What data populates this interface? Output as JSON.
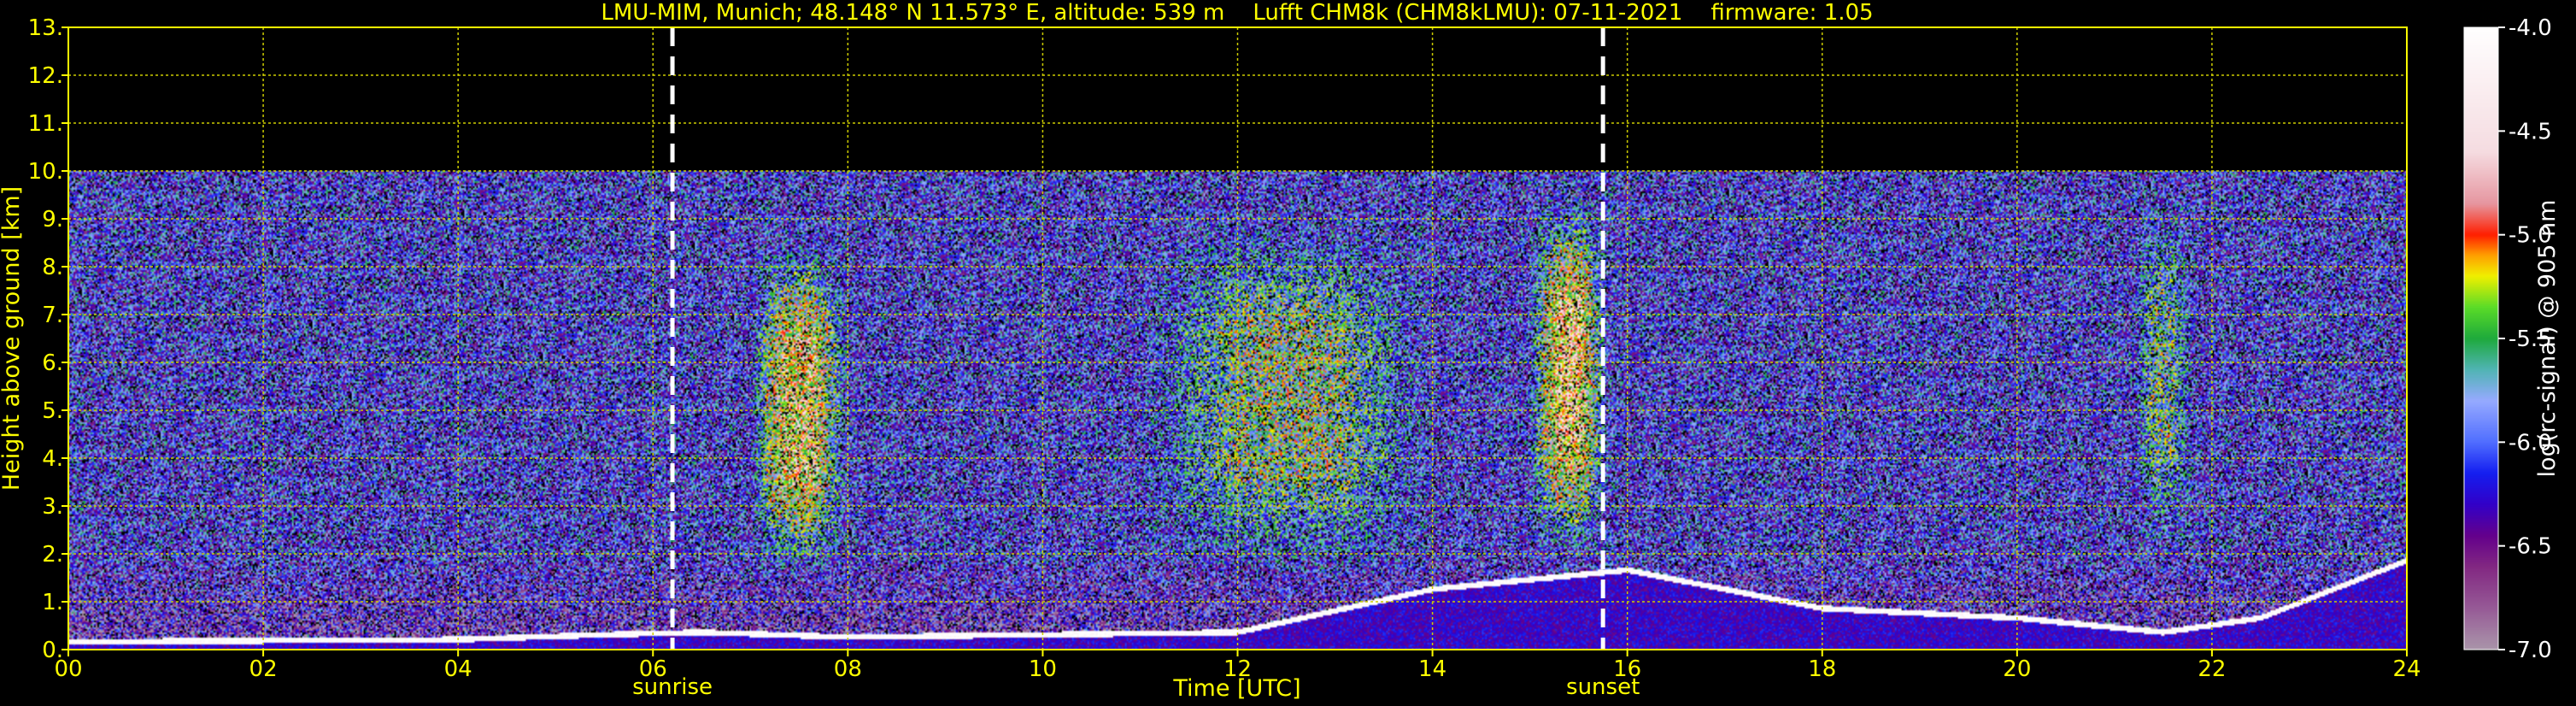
{
  "chart_data": {
    "type": "heatmap",
    "title": "LMU-MIM, Munich; 48.148° N 11.573° E, altitude: 539 m    Lufft CHM8k (CHM8kLMU): 07-11-2021    firmware: 1.05",
    "xlabel": "Time [UTC]",
    "ylabel": "Height above ground [km]",
    "xlim": [
      0,
      24
    ],
    "ylim": [
      0,
      13
    ],
    "x_ticks": [
      "00",
      "02",
      "04",
      "06",
      "08",
      "10",
      "12",
      "14",
      "16",
      "18",
      "20",
      "22",
      "24"
    ],
    "y_ticks": [
      "0.",
      "1.",
      "2.",
      "3.",
      "4.",
      "5.",
      "6.",
      "7.",
      "8.",
      "9.",
      "10.",
      "11.",
      "12.",
      "13."
    ],
    "grid": true,
    "data_top_km": 10,
    "markers": [
      {
        "label": "sunrise",
        "x": 6.2
      },
      {
        "label": "sunset",
        "x": 15.75
      }
    ],
    "colorbar": {
      "label": "log(rc-signal) @ 905 nm",
      "range": [
        -7.0,
        -4.0
      ],
      "ticks": [
        "-4.0",
        "-4.5",
        "-5.0",
        "-5.5",
        "-6.0",
        "-6.5",
        "-7.0"
      ]
    },
    "features": [
      {
        "name": "background",
        "level": -6.1
      },
      {
        "name": "aerosol_column_1",
        "t_start": 7.0,
        "t_end": 8.0,
        "max_level": -5.0,
        "height_km": [
          1.5,
          8.5
        ]
      },
      {
        "name": "aerosol_column_2",
        "t_start": 11.0,
        "t_end": 14.0,
        "max_level": -5.5,
        "height_km": [
          1.5,
          9.0
        ]
      },
      {
        "name": "aerosol_column_3",
        "t_start": 15.0,
        "t_end": 15.8,
        "max_level": -4.9,
        "height_km": [
          2.0,
          9.5
        ]
      },
      {
        "name": "aerosol_column_4",
        "t_start": 21.2,
        "t_end": 21.8,
        "max_level": -5.6,
        "height_km": [
          2.0,
          9.5
        ]
      },
      {
        "name": "boundary_layer_top",
        "points": [
          [
            0,
            0.1
          ],
          [
            4,
            0.15
          ],
          [
            5.5,
            0.25
          ],
          [
            6.5,
            0.3
          ],
          [
            8,
            0.2
          ],
          [
            12,
            0.3
          ],
          [
            14,
            1.2
          ],
          [
            15,
            1.4
          ],
          [
            16,
            1.6
          ],
          [
            17,
            1.2
          ],
          [
            18,
            0.8
          ],
          [
            20,
            0.6
          ],
          [
            21.5,
            0.3
          ],
          [
            22.5,
            0.6
          ],
          [
            24,
            1.8
          ]
        ]
      }
    ],
    "colors": {
      "axis": "#ffff00",
      "grid": "#cccc00",
      "marker": "#ffffff"
    }
  }
}
